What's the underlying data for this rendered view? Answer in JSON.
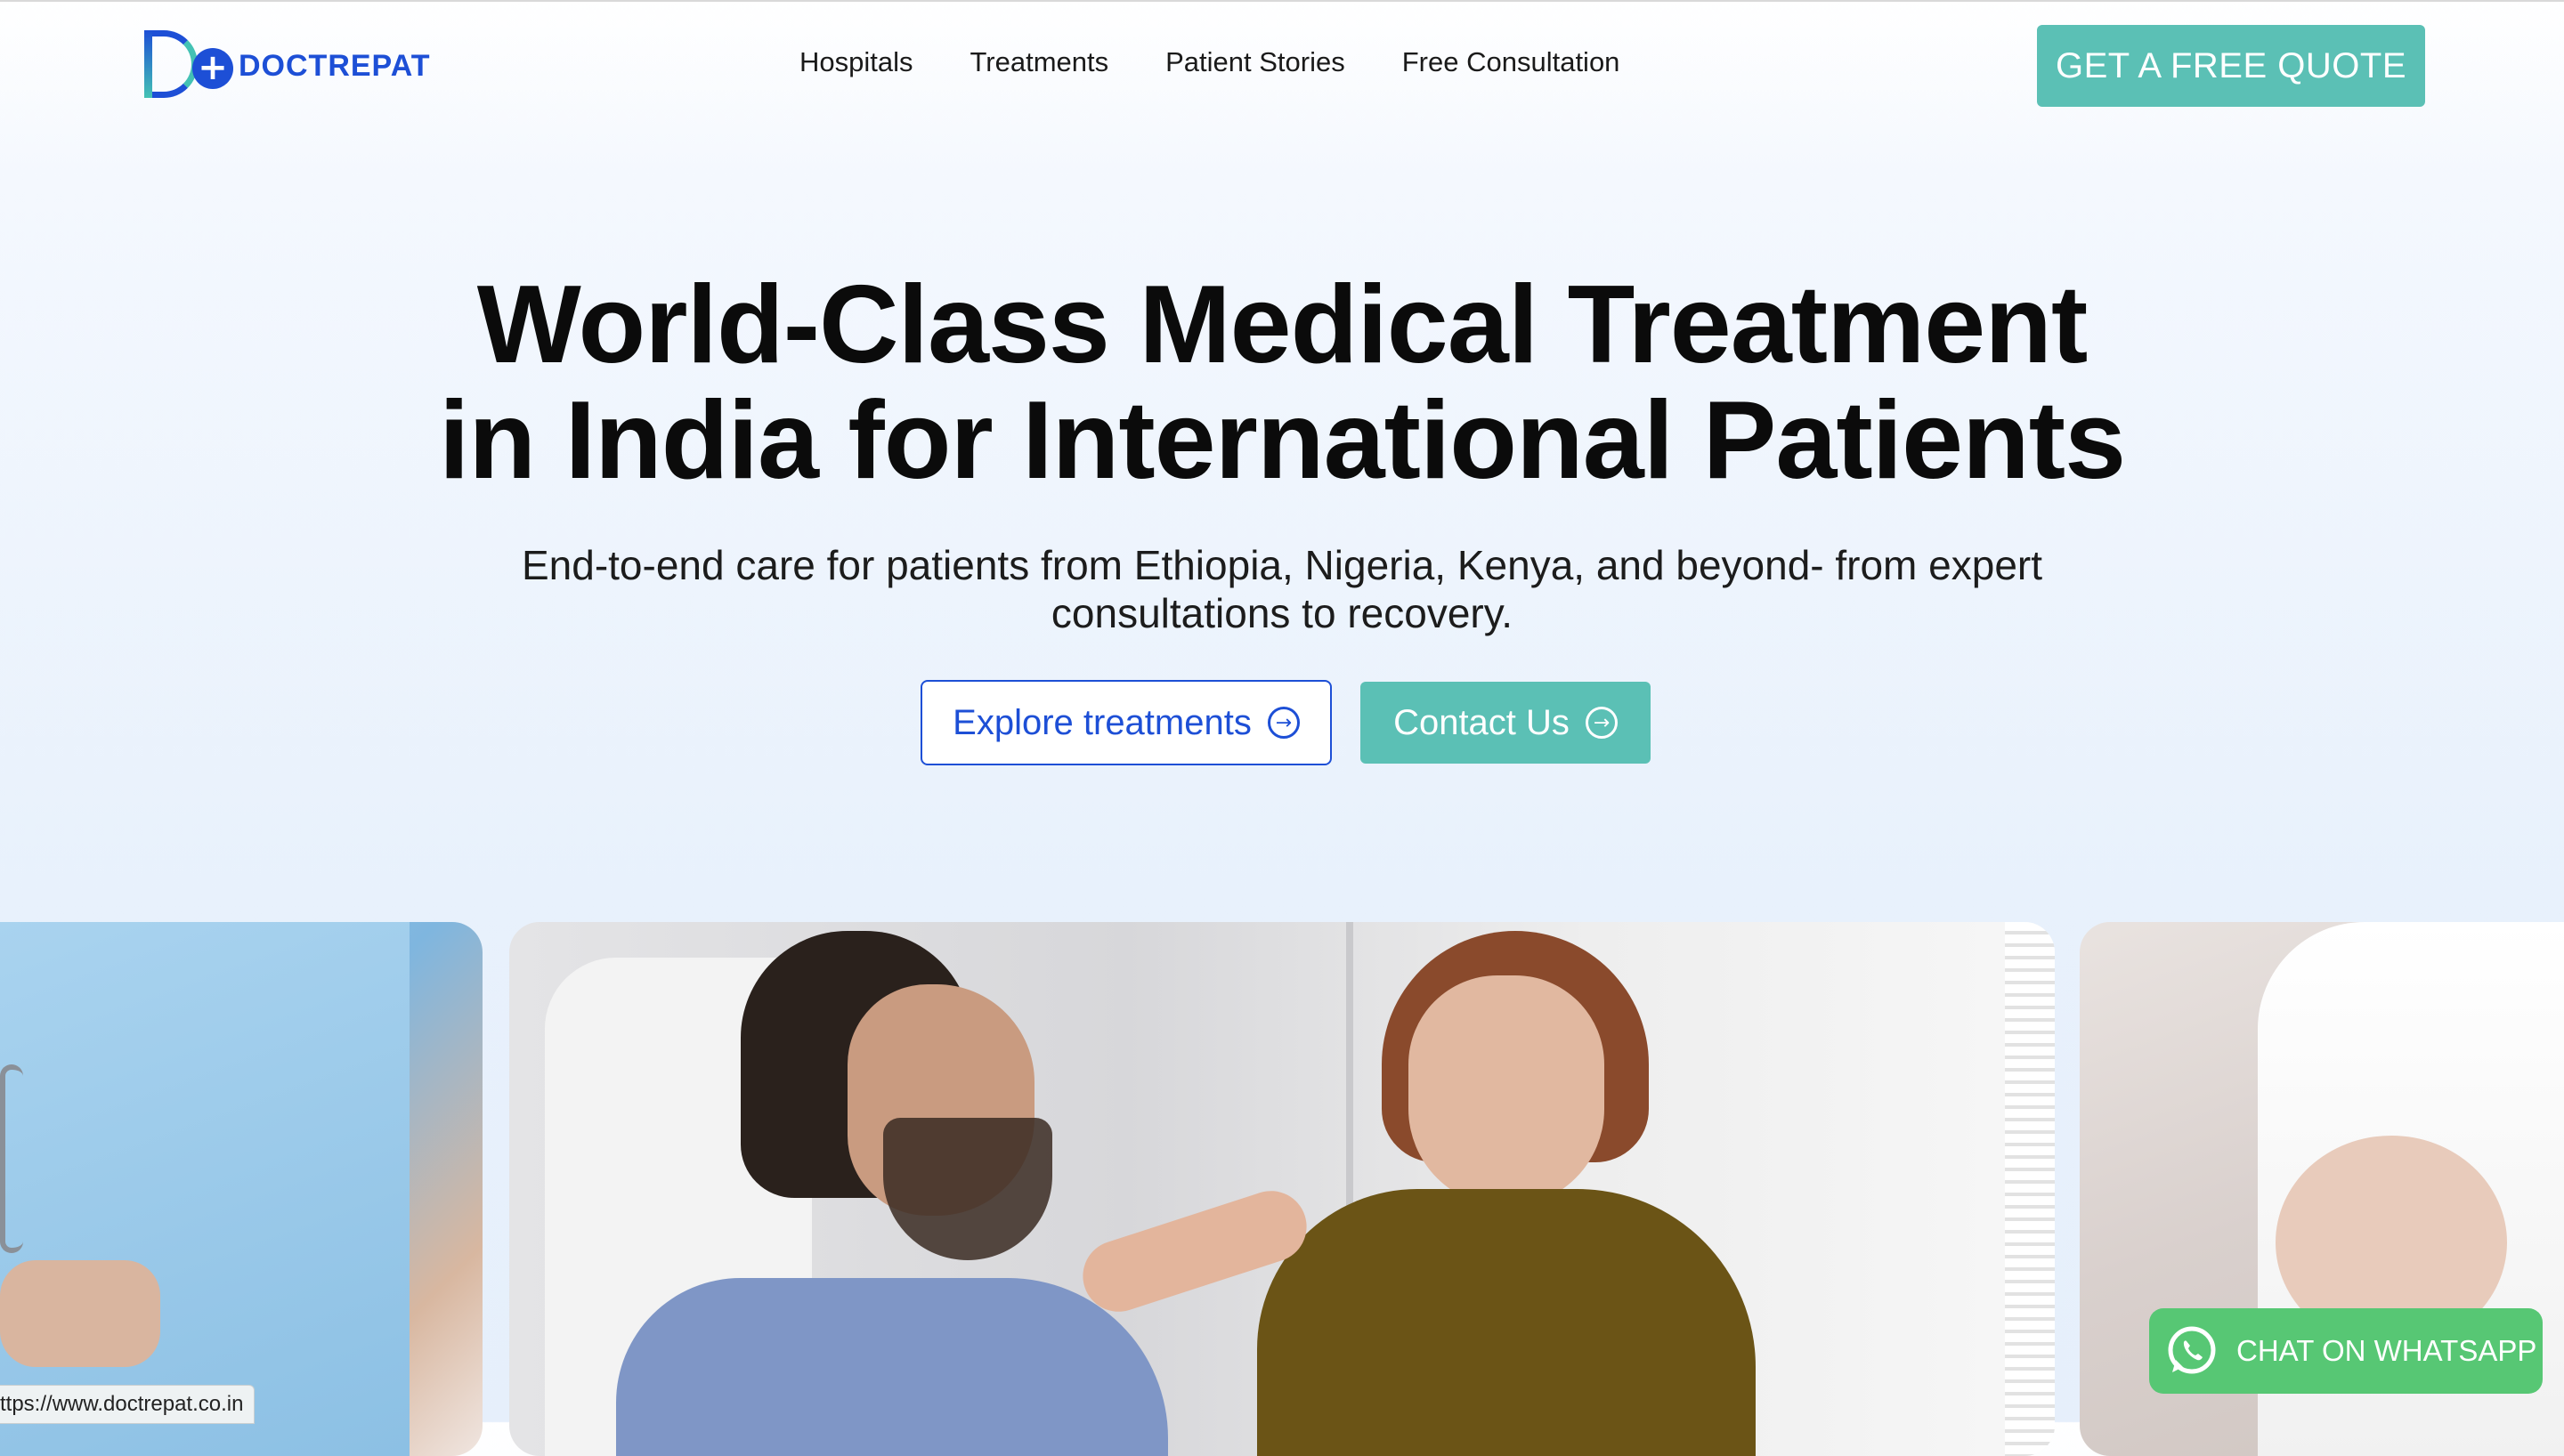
{
  "brand": {
    "name": "DOCTREPAT",
    "primary": "#1d4fd6",
    "accent": "#5bc0b5"
  },
  "nav": {
    "items": [
      {
        "label": "Hospitals"
      },
      {
        "label": "Treatments"
      },
      {
        "label": "Patient Stories"
      },
      {
        "label": "Free Consultation"
      }
    ],
    "cta_label": "GET A FREE QUOTE"
  },
  "hero": {
    "title_line1": "World-Class Medical Treatment",
    "title_line2": "in India for International Patients",
    "subtitle": "End-to-end care for patients from Ethiopia, Nigeria, Kenya, and beyond- from expert consultations to recovery.",
    "explore_label": "Explore treatments",
    "contact_label": "Contact Us"
  },
  "gallery": {
    "cards": [
      {
        "subject": "nurse-in-scrubs"
      },
      {
        "subject": "patient-with-companion"
      },
      {
        "subject": "mother-with-baby"
      }
    ]
  },
  "whatsapp": {
    "label": "CHAT ON WHATSAPP",
    "color": "#57c774"
  },
  "status_bar": {
    "url": "ttps://www.doctrepat.co.in"
  }
}
